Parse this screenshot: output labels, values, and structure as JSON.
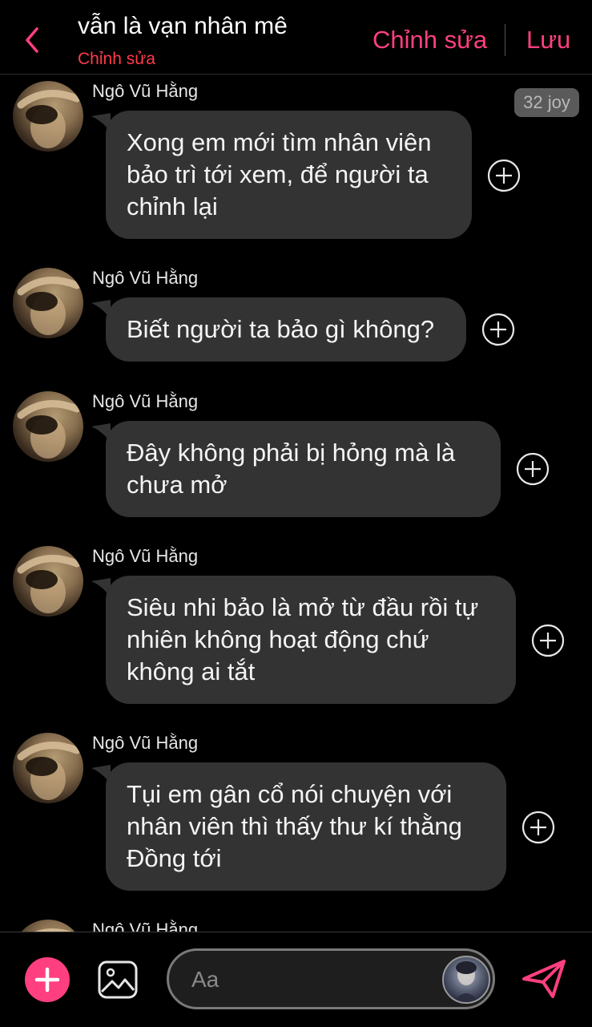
{
  "header": {
    "title": "vẫn là vạn nhân mê",
    "subtitle": "Chỉnh sửa",
    "edit_label": "Chỉnh sửa",
    "save_label": "Lưu"
  },
  "badge": {
    "joy_label": "32 joy"
  },
  "messages": [
    {
      "sender": "Ngô Vũ Hằng",
      "text": "Xong em mới tìm nhân viên\nbảo trì tới xem, để người ta\nchỉnh lại"
    },
    {
      "sender": "Ngô Vũ Hằng",
      "text": "Biết người ta bảo gì không?"
    },
    {
      "sender": "Ngô Vũ Hằng",
      "text": "Đây không phải bị hỏng mà là\nchưa mở"
    },
    {
      "sender": "Ngô Vũ Hằng",
      "text": "Siêu nhi bảo là mở từ đầu rồi tự\nnhiên không hoạt động chứ\nkhông ai tắt"
    },
    {
      "sender": "Ngô Vũ Hằng",
      "text": "Tụi em gân cổ nói chuyện với\nnhân viên thì thấy thư kí thằng\nĐồng tới"
    },
    {
      "sender": "Ngô Vũ Hằng",
      "text": ""
    }
  ],
  "composer": {
    "placeholder": "Aa"
  },
  "icons": {
    "back": "chevron-left-icon",
    "react": "plus-circle-icon",
    "add": "plus-icon",
    "gallery": "image-icon",
    "send": "paper-plane-icon"
  },
  "colors": {
    "accent": "#ff3f80",
    "subtitle": "#ff3b4a",
    "bubble": "#333333",
    "background": "#000000"
  }
}
